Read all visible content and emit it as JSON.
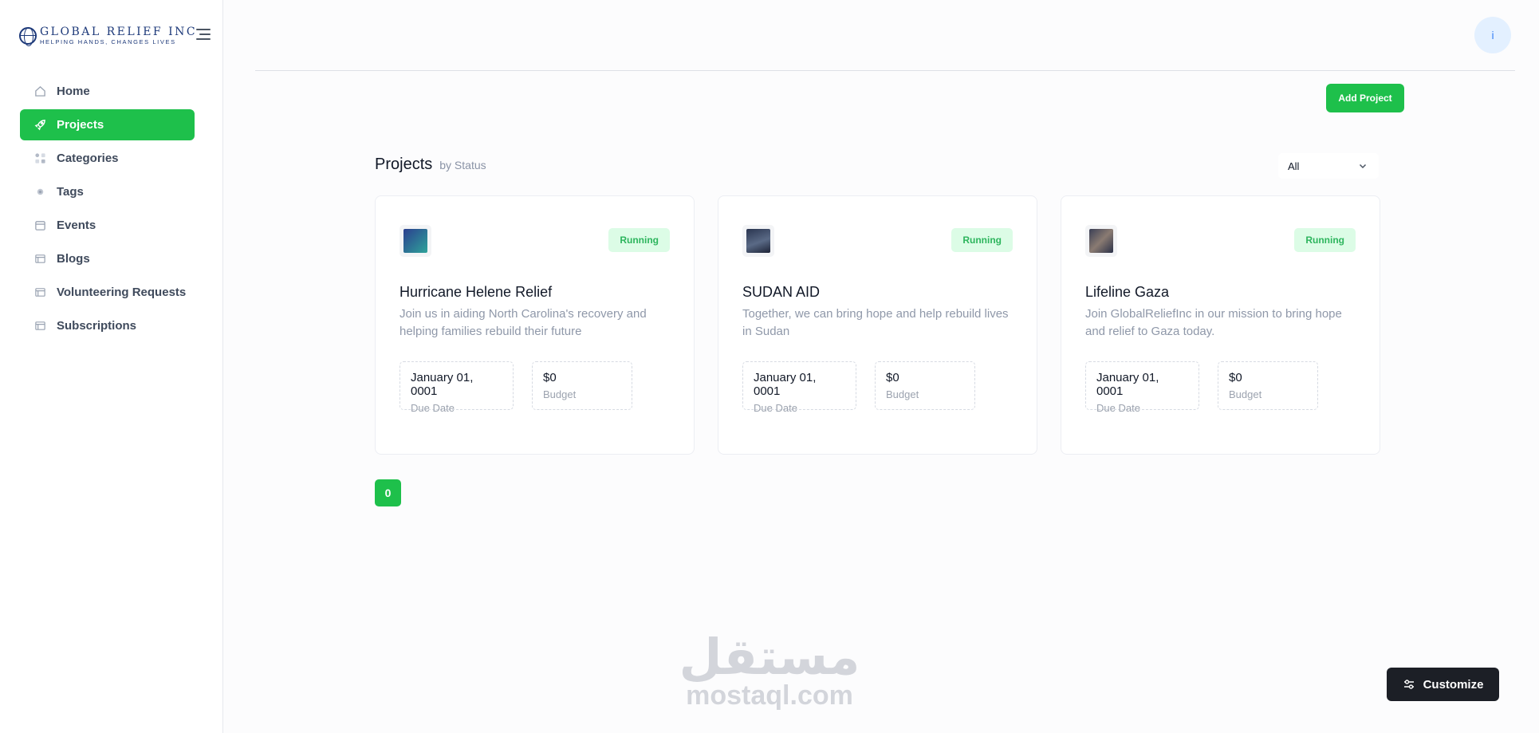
{
  "brand": {
    "name": "GLOBAL RELIEF INC",
    "tagline": "HELPING HANDS, CHANGES LIVES"
  },
  "sidebar": {
    "items": [
      {
        "label": "Home",
        "icon": "home-icon",
        "active": false
      },
      {
        "label": "Projects",
        "icon": "rocket-icon",
        "active": true
      },
      {
        "label": "Categories",
        "icon": "categories-icon",
        "active": false
      },
      {
        "label": "Tags",
        "icon": "tag-icon",
        "active": false
      },
      {
        "label": "Events",
        "icon": "calendar-icon",
        "active": false
      },
      {
        "label": "Blogs",
        "icon": "document-icon",
        "active": false
      },
      {
        "label": "Volunteering Requests",
        "icon": "document-icon",
        "active": false
      },
      {
        "label": "Subscriptions",
        "icon": "document-icon",
        "active": false
      }
    ]
  },
  "header": {
    "avatar_initial": "i"
  },
  "toolbar": {
    "add_label": "Add Project"
  },
  "section": {
    "title": "Projects",
    "subtitle": "by Status",
    "filter_value": "All"
  },
  "projects": [
    {
      "title": "Hurricane Helene Relief",
      "description": "Join us in aiding North Carolina's recovery and helping families rebuild their future",
      "status": "Running",
      "due_date": "January 01, 0001",
      "due_label": "Due Date",
      "budget": "$0",
      "budget_label": "Budget"
    },
    {
      "title": "SUDAN AID",
      "description": "Together, we can bring hope and help rebuild lives in Sudan",
      "status": "Running",
      "due_date": "January 01, 0001",
      "due_label": "Due Date",
      "budget": "$0",
      "budget_label": "Budget"
    },
    {
      "title": "Lifeline Gaza",
      "description": "Join GlobalReliefInc in our mission to bring hope and relief to Gaza today.",
      "status": "Running",
      "due_date": "January 01, 0001",
      "due_label": "Due Date",
      "budget": "$0",
      "budget_label": "Budget"
    }
  ],
  "pagination": {
    "current": "0"
  },
  "watermark": {
    "arabic": "مستقل",
    "latin": "mostaql.com"
  },
  "customize": {
    "label": "Customize"
  },
  "colors": {
    "accent": "#1ec04b",
    "badge_bg": "#dcfce6",
    "badge_text": "#2db55d",
    "dark_button": "#1c1f26"
  }
}
